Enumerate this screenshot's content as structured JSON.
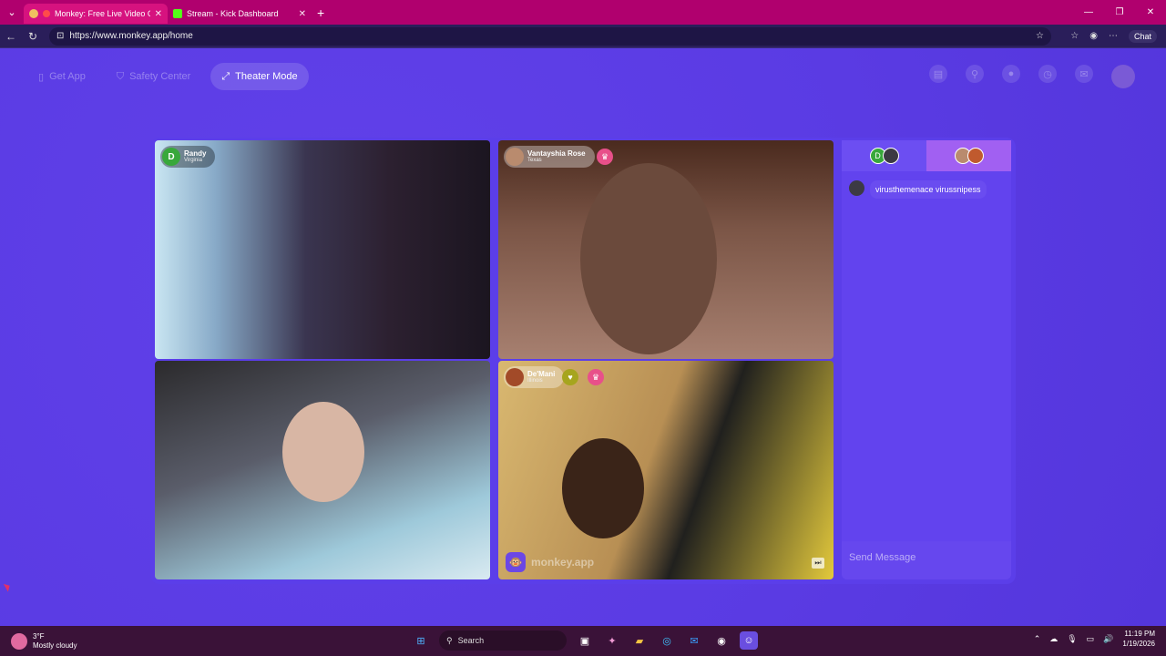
{
  "browser": {
    "tabs": [
      {
        "title": "Monkey: Free Live Video Chat",
        "active": true,
        "icon": "monkey-favicon"
      },
      {
        "title": "Stream - Kick Dashboard",
        "active": false,
        "icon": "kick-favicon"
      }
    ],
    "new_tab": "+",
    "url": "https://www.monkey.app/home",
    "chat_label": "Chat"
  },
  "nav": {
    "get_app": "Get App",
    "safety_center": "Safety Center",
    "theater_mode": "Theater Mode"
  },
  "videos": [
    {
      "name": "Randy",
      "location": "Virginia",
      "initial": "D",
      "avatar_color": "#38a83b"
    },
    {
      "name": "Vantayshia Rose",
      "location": "Texas",
      "initial": "",
      "avatar_color": "#b98b6e"
    },
    {
      "name": "",
      "location": "",
      "initial": "",
      "avatar_color": ""
    },
    {
      "name": "De'Mani",
      "location": "Illinois",
      "initial": "",
      "avatar_color": "#a24a28"
    }
  ],
  "watermark": "monkey.app",
  "chat": {
    "tab1_initial": "D",
    "messages": [
      {
        "text": "virusthemenace virussnipess"
      }
    ],
    "send_placeholder": "Send Message"
  },
  "taskbar": {
    "temperature": "3°F",
    "weather": "Mostly cloudy",
    "search": "Search",
    "time": "11:19 PM",
    "date": "1/19/2026"
  }
}
